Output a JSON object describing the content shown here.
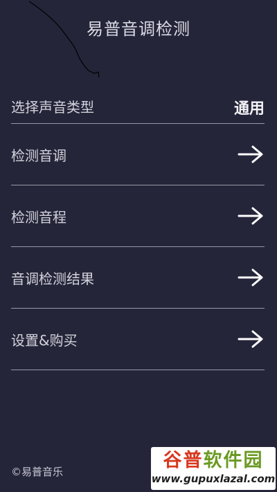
{
  "header": {
    "title": "易普音调检测"
  },
  "menu": {
    "voice_type": {
      "label": "选择声音类型",
      "value": "通用"
    },
    "items": [
      {
        "label": "检测音调",
        "icon": "arrow-right-icon"
      },
      {
        "label": "检测音程",
        "icon": "arrow-right-icon"
      },
      {
        "label": "音调检测结果",
        "icon": "arrow-right-icon"
      },
      {
        "label": "设置&购买",
        "icon": "arrow-right-icon"
      }
    ]
  },
  "footer": {
    "copyright": "©易普音乐"
  },
  "watermark": {
    "title_a": "谷普",
    "title_b": "软件园",
    "url": "www.gupuxlazal.com"
  },
  "colors": {
    "background": "#25253a",
    "divider": "#9a9aaa",
    "text": "#e9e9f0"
  }
}
